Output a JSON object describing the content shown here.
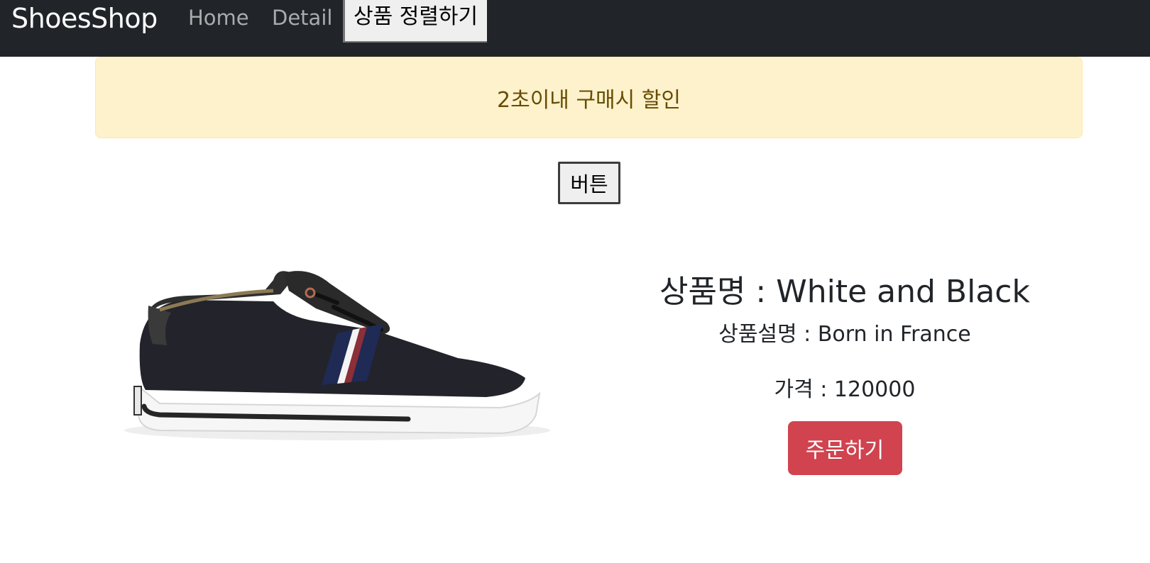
{
  "navbar": {
    "brand": "ShoesShop",
    "links": [
      "Home",
      "Detail"
    ],
    "sort_button": "상품 정렬하기"
  },
  "alert": {
    "text": "2초이내 구매시 할인"
  },
  "plain_button": {
    "label": "버튼"
  },
  "product": {
    "name": "상품명 : White and Black",
    "description": "상품설명 : Born in France",
    "price": "가격 : 120000",
    "order_button": "주문하기"
  },
  "colors": {
    "navbar_bg": "#212529",
    "alert_bg": "#fdf2cc",
    "alert_text": "#664d03",
    "order_button": "#d0434f"
  },
  "icons": {
    "product_image": "sneaker-image"
  }
}
